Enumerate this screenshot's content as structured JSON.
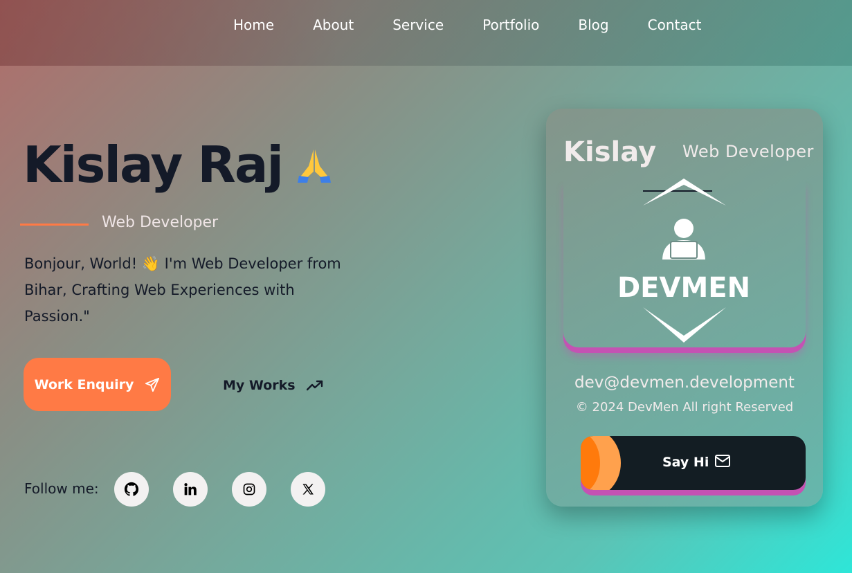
{
  "nav": {
    "items": [
      "Home",
      "About",
      "Service",
      "Portfolio",
      "Blog",
      "Contact"
    ]
  },
  "hero": {
    "name": "Kislay Raj",
    "role": "Web Developer",
    "bio": "Bonjour, World! 👋 I'm Web Developer from Bihar, Crafting Web Experiences with Passion.\"",
    "primary_button": "Work Enquiry",
    "secondary_button": "My Works",
    "follow_label": "Follow me:",
    "social_icons": [
      "github-icon",
      "linkedin-icon",
      "instagram-icon",
      "x-icon"
    ]
  },
  "card": {
    "name": "Kislay",
    "role": "Web Developer",
    "logo_text": "DEVMEN",
    "email": "dev@devmen.development",
    "copyright": "© 2024 DevMen All right Reserved",
    "button_label": "Say Hi"
  },
  "colors": {
    "accent": "#ff7a45",
    "dark": "#131d23",
    "magenta": "#c452b3"
  }
}
